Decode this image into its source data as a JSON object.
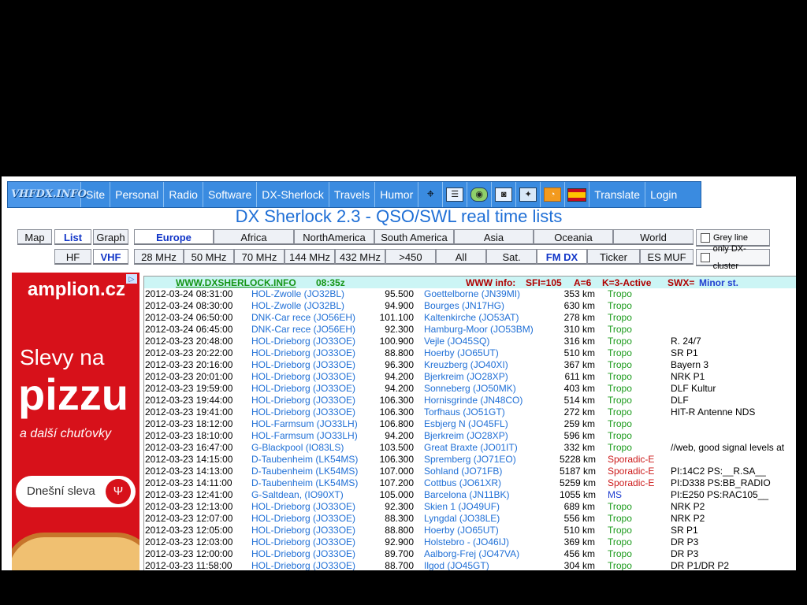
{
  "nav": {
    "logo": "VHFDX.INFO",
    "items": [
      "Site",
      "Personal",
      "Radio",
      "Software",
      "DX-Sherlock",
      "Travels",
      "Humor"
    ],
    "icons": [
      "binoculars-icon",
      "list-icon",
      "globe-icon",
      "camera-icon",
      "map-icon",
      "rss-icon",
      "spain-flag-icon"
    ],
    "tail_items": [
      "Translate",
      "Login"
    ]
  },
  "page_title": "DX Sherlock 2.3 - QSO/SWL real time lists",
  "view_tabs": [
    "Map",
    "List",
    "Graph"
  ],
  "band_group_tabs": [
    "HF",
    "VHF"
  ],
  "region_tabs": [
    "Europe",
    "Africa",
    "NorthAmerica",
    "South America",
    "Asia",
    "Oceania",
    "World"
  ],
  "band_tabs": [
    "28 MHz",
    "50 MHz",
    "70 MHz",
    "144 MHz",
    "432 MHz",
    ">450",
    "All",
    "Sat.",
    "FM DX",
    "Ticker",
    "ES MUF"
  ],
  "checkboxes": [
    "Grey line",
    "only DX-cluster"
  ],
  "ad": {
    "brand": "amplion.cz",
    "line1": "Slevy na",
    "line2": "pizzu",
    "line3": "a další chuťovky",
    "button": "Dnešní sleva",
    "badge": "▷"
  },
  "header": {
    "site": "WWW.DXSHERLOCK.INFO",
    "time": "08:35z",
    "www_info": "WWW info:",
    "sfi": "SFI=105",
    "a": "A=6",
    "k": "K=3-Active",
    "swx": "SWX=",
    "swx_val": "Minor st."
  },
  "mode_colors": {
    "Tropo": "#1a9a1a",
    "Sporadic-E": "#cc1a1a",
    "MS": "#1f3ed0"
  },
  "rows": [
    {
      "date": "2012-03-24 08:31:00",
      "tx": "HOL-Zwolle (JO32BL)",
      "freq": "95.500",
      "rx": "Goettelborne (JN39MI)",
      "dist": "353 km",
      "mode": "Tropo",
      "comment": ""
    },
    {
      "date": "2012-03-24 08:30:00",
      "tx": "HOL-Zwolle (JO32BL)",
      "freq": "94.900",
      "rx": "Bourges (JN17HG)",
      "dist": "630 km",
      "mode": "Tropo",
      "comment": ""
    },
    {
      "date": "2012-03-24 06:50:00",
      "tx": "DNK-Car rece (JO56EH)",
      "freq": "101.100",
      "rx": "Kaltenkirche (JO53AT)",
      "dist": "278 km",
      "mode": "Tropo",
      "comment": ""
    },
    {
      "date": "2012-03-24 06:45:00",
      "tx": "DNK-Car rece (JO56EH)",
      "freq": "92.300",
      "rx": "Hamburg-Moor (JO53BM)",
      "dist": "310 km",
      "mode": "Tropo",
      "comment": ""
    },
    {
      "date": "2012-03-23 20:48:00",
      "tx": "HOL-Drieborg (JO33OE)",
      "freq": "100.900",
      "rx": "Vejle (JO45SQ)",
      "dist": "316 km",
      "mode": "Tropo",
      "comment": "R. 24/7"
    },
    {
      "date": "2012-03-23 20:22:00",
      "tx": "HOL-Drieborg (JO33OE)",
      "freq": "88.800",
      "rx": "Hoerby (JO65UT)",
      "dist": "510 km",
      "mode": "Tropo",
      "comment": "SR P1"
    },
    {
      "date": "2012-03-23 20:16:00",
      "tx": "HOL-Drieborg (JO33OE)",
      "freq": "96.300",
      "rx": "Kreuzberg (JO40XI)",
      "dist": "367 km",
      "mode": "Tropo",
      "comment": "Bayern 3"
    },
    {
      "date": "2012-03-23 20:01:00",
      "tx": "HOL-Drieborg (JO33OE)",
      "freq": "94.200",
      "rx": "Bjerkreim (JO28XP)",
      "dist": "611 km",
      "mode": "Tropo",
      "comment": "NRK P1"
    },
    {
      "date": "2012-03-23 19:59:00",
      "tx": "HOL-Drieborg (JO33OE)",
      "freq": "94.200",
      "rx": "Sonneberg (JO50MK)",
      "dist": "403 km",
      "mode": "Tropo",
      "comment": "DLF Kultur"
    },
    {
      "date": "2012-03-23 19:44:00",
      "tx": "HOL-Drieborg (JO33OE)",
      "freq": "106.300",
      "rx": "Hornisgrinde (JN48CO)",
      "dist": "514 km",
      "mode": "Tropo",
      "comment": "DLF"
    },
    {
      "date": "2012-03-23 19:41:00",
      "tx": "HOL-Drieborg (JO33OE)",
      "freq": "106.300",
      "rx": "Torfhaus (JO51GT)",
      "dist": "272 km",
      "mode": "Tropo",
      "comment": "HIT-R Antenne NDS"
    },
    {
      "date": "2012-03-23 18:12:00",
      "tx": "HOL-Farmsum (JO33LH)",
      "freq": "106.800",
      "rx": "Esbjerg N (JO45FL)",
      "dist": "259 km",
      "mode": "Tropo",
      "comment": ""
    },
    {
      "date": "2012-03-23 18:10:00",
      "tx": "HOL-Farmsum (JO33LH)",
      "freq": "94.200",
      "rx": "Bjerkreim (JO28XP)",
      "dist": "596 km",
      "mode": "Tropo",
      "comment": ""
    },
    {
      "date": "2012-03-23 16:47:00",
      "tx": "G-Blackpool (IO83LS)",
      "freq": "103.500",
      "rx": "Great Braxte (JO01IT)",
      "dist": "332 km",
      "mode": "Tropo",
      "comment": "//web, good signal levels at"
    },
    {
      "date": "2012-03-23 14:15:00",
      "tx": "D-Taubenheim (LK54MS)",
      "freq": "106.300",
      "rx": "Spremberg (JO71EO)",
      "dist": "5228 km",
      "mode": "Sporadic-E",
      "comment": ""
    },
    {
      "date": "2012-03-23 14:13:00",
      "tx": "D-Taubenheim (LK54MS)",
      "freq": "107.000",
      "rx": "Sohland (JO71FB)",
      "dist": "5187 km",
      "mode": "Sporadic-E",
      "comment": "PI:14C2 PS:__R.SA__"
    },
    {
      "date": "2012-03-23 14:11:00",
      "tx": "D-Taubenheim (LK54MS)",
      "freq": "107.200",
      "rx": "Cottbus (JO61XR)",
      "dist": "5259 km",
      "mode": "Sporadic-E",
      "comment": "PI:D338 PS:BB_RADIO"
    },
    {
      "date": "2012-03-23 12:41:00",
      "tx": "G-Saltdean, (IO90XT)",
      "freq": "105.000",
      "rx": "Barcelona (JN11BK)",
      "dist": "1055 km",
      "mode": "MS",
      "comment": "PI:E250 PS:RAC105__"
    },
    {
      "date": "2012-03-23 12:13:00",
      "tx": "HOL-Drieborg (JO33OE)",
      "freq": "92.300",
      "rx": "Skien 1 (JO49UF)",
      "dist": "689 km",
      "mode": "Tropo",
      "comment": "NRK P2"
    },
    {
      "date": "2012-03-23 12:07:00",
      "tx": "HOL-Drieborg (JO33OE)",
      "freq": "88.300",
      "rx": "Lyngdal (JO38LE)",
      "dist": "556 km",
      "mode": "Tropo",
      "comment": "NRK P2"
    },
    {
      "date": "2012-03-23 12:05:00",
      "tx": "HOL-Drieborg (JO33OE)",
      "freq": "88.800",
      "rx": "Hoerby (JO65UT)",
      "dist": "510 km",
      "mode": "Tropo",
      "comment": "SR P1"
    },
    {
      "date": "2012-03-23 12:03:00",
      "tx": "HOL-Drieborg (JO33OE)",
      "freq": "92.900",
      "rx": "Holstebro - (JO46IJ)",
      "dist": "369 km",
      "mode": "Tropo",
      "comment": "DR P3"
    },
    {
      "date": "2012-03-23 12:00:00",
      "tx": "HOL-Drieborg (JO33OE)",
      "freq": "89.700",
      "rx": "Aalborg-Frej (JO47VA)",
      "dist": "456 km",
      "mode": "Tropo",
      "comment": "DR P3"
    },
    {
      "date": "2012-03-23 11:58:00",
      "tx": "HOL-Drieborg (JO33OE)",
      "freq": "88.700",
      "rx": "Ilgod (JO45GT)",
      "dist": "304 km",
      "mode": "Tropo",
      "comment": "DR P1/DR P2"
    }
  ]
}
